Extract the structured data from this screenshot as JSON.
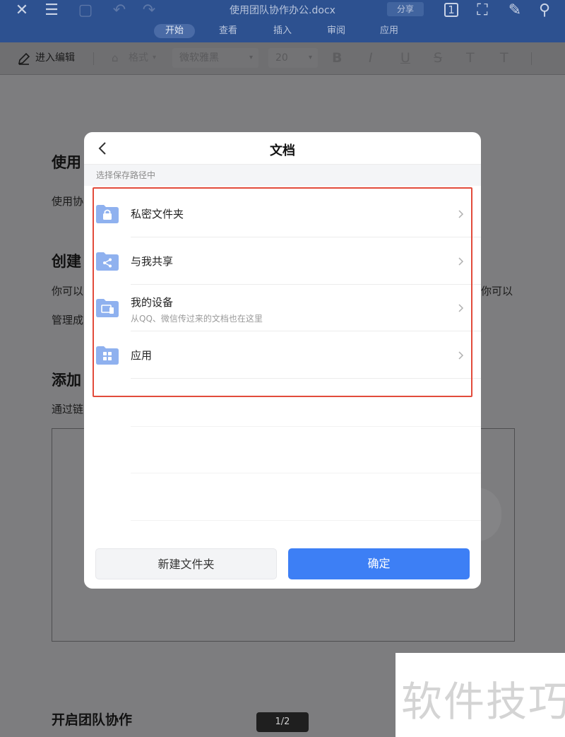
{
  "app": {
    "doc_title": "使用团队协作办公.docx",
    "share_label": "分享",
    "page_indicator": "1/2"
  },
  "tabs": [
    {
      "label": "开始",
      "active": true
    },
    {
      "label": "查看",
      "active": false
    },
    {
      "label": "插入",
      "active": false
    },
    {
      "label": "审阅",
      "active": false
    },
    {
      "label": "应用",
      "active": false
    }
  ],
  "toolbar": {
    "edit_label": "进入编辑",
    "format_label": "格式",
    "font_name": "微软雅黑",
    "font_size": "20",
    "bold": "B",
    "italic": "I",
    "underline": "U",
    "strike": "S",
    "superscript": "T",
    "subscript": "T"
  },
  "document": {
    "h1": "使用",
    "p1": "使用协",
    "h2": "创建",
    "p2a": "你可以",
    "p2b_right": "你可以",
    "p3": "管理成",
    "h3": "添加",
    "p4": "通过链",
    "h4": "开启团队协作"
  },
  "dialog": {
    "title": "文档",
    "path_hint": "选择保存路径中",
    "items": [
      {
        "label": "私密文件夹",
        "icon": "lock-folder-icon"
      },
      {
        "label": "与我共享",
        "icon": "share-folder-icon"
      },
      {
        "label": "我的设备",
        "sublabel": "从QQ、微信传过来的文档也在这里",
        "icon": "device-folder-icon"
      },
      {
        "label": "应用",
        "icon": "apps-folder-icon"
      }
    ],
    "new_folder_label": "新建文件夹",
    "confirm_label": "确定"
  },
  "watermark": "软件技巧",
  "colors": {
    "accent": "#3d7ff5",
    "folder": "#8fb1ef",
    "highlight": "#e24b3b",
    "topbar": "#2d5190"
  }
}
